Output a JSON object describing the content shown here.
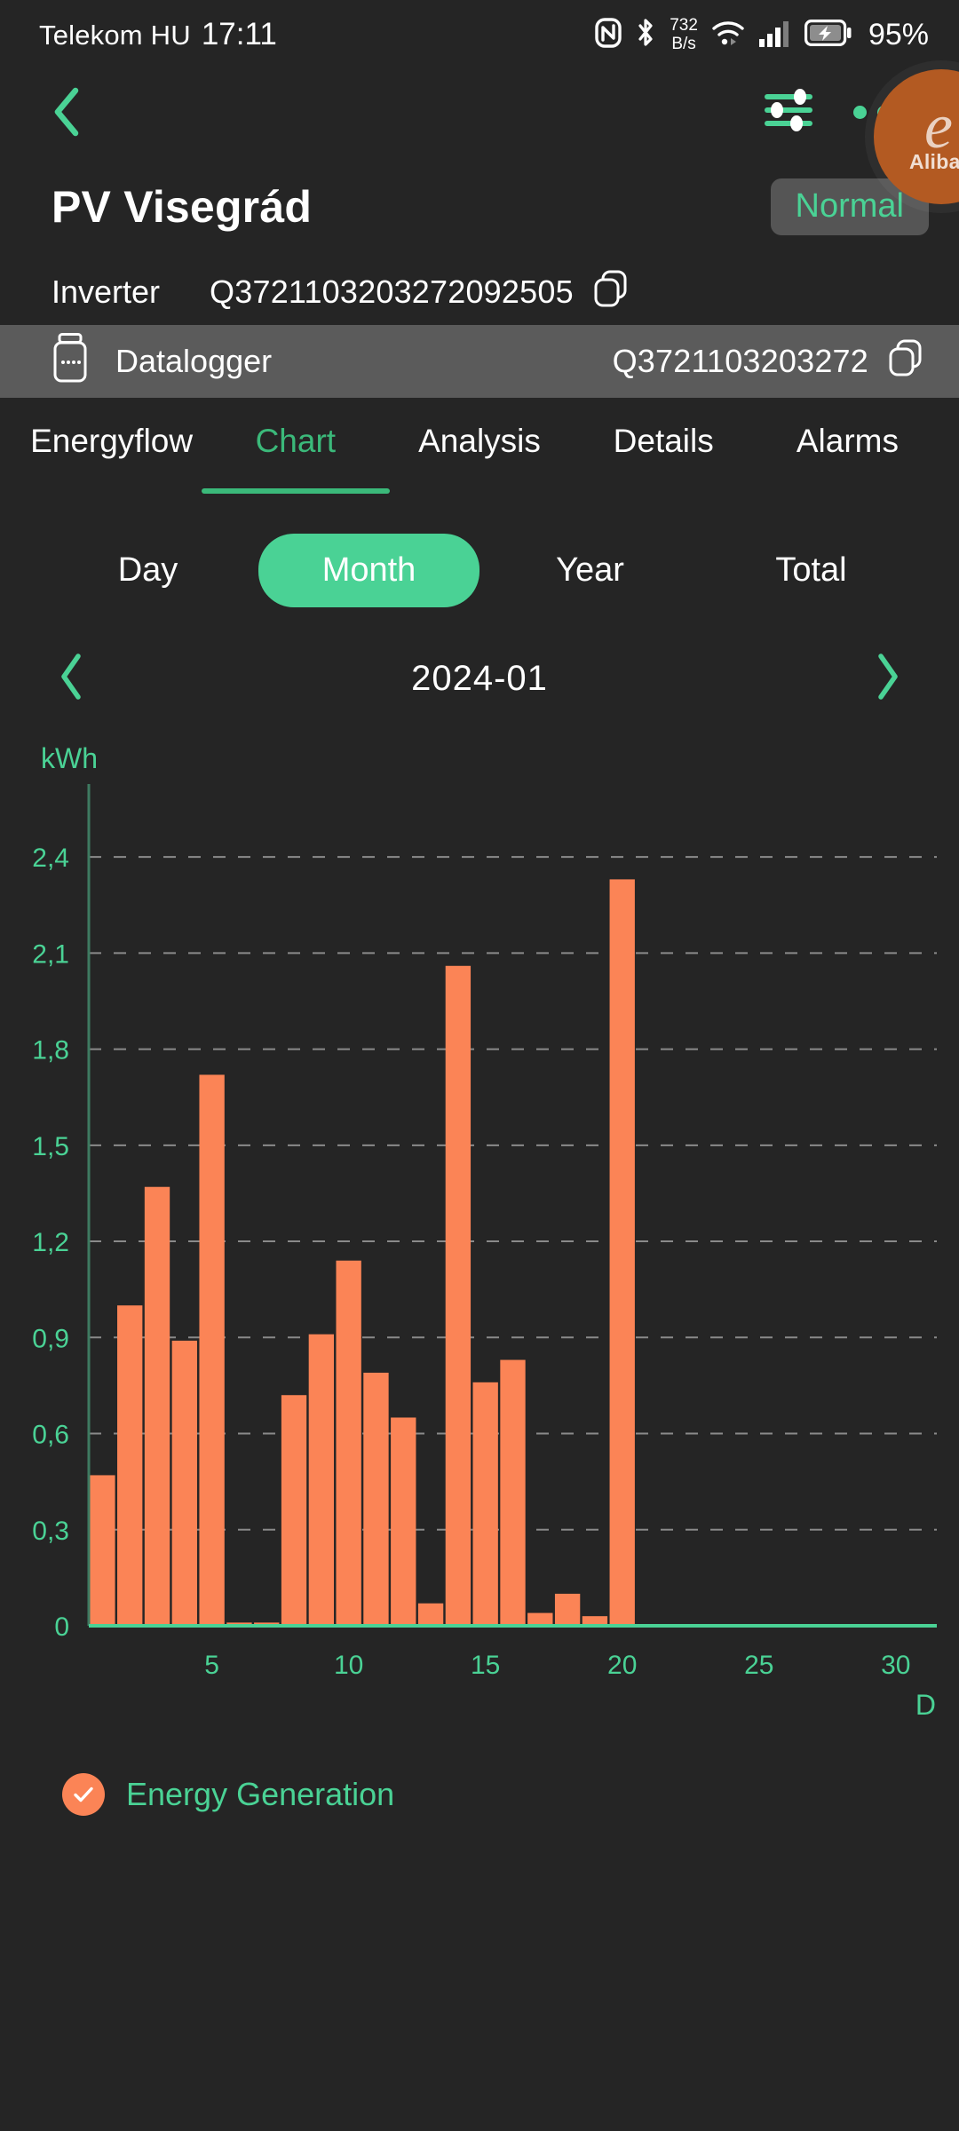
{
  "status_bar": {
    "carrier": "Telekom HU",
    "time": "17:11",
    "network_speed_value": "732",
    "network_speed_unit": "B/s",
    "battery_percent": "95%",
    "icons": [
      "nfc-icon",
      "bluetooth-icon",
      "wifi-icon",
      "cellular-signal-icon",
      "battery-charging-icon"
    ]
  },
  "nav_bar": {
    "back_icon": "chevron-left-icon",
    "settings_icon": "sliders-icon",
    "more_icon": "more-dots-icon",
    "floating_badge": {
      "mark": "e",
      "name": "Alibab"
    }
  },
  "header": {
    "title": "PV Visegrád",
    "status_badge": "Normal"
  },
  "devices": {
    "inverter": {
      "label": "Inverter",
      "value": "Q3721103203272092505",
      "copy_icon": "copy-icon"
    },
    "datalogger": {
      "label": "Datalogger",
      "value": "Q3721103203272",
      "device_icon": "datalogger-icon",
      "copy_icon": "copy-icon"
    }
  },
  "tabs": [
    {
      "label": "Energyflow",
      "active": false
    },
    {
      "label": "Chart",
      "active": true
    },
    {
      "label": "Analysis",
      "active": false
    },
    {
      "label": "Details",
      "active": false
    },
    {
      "label": "Alarms",
      "active": false
    }
  ],
  "periods": [
    {
      "label": "Day",
      "active": false
    },
    {
      "label": "Month",
      "active": true
    },
    {
      "label": "Year",
      "active": false
    },
    {
      "label": "Total",
      "active": false
    }
  ],
  "date_nav": {
    "prev_icon": "chevron-left-icon",
    "next_icon": "chevron-right-icon",
    "current": "2024-01"
  },
  "legend": [
    {
      "label": "Energy Generation",
      "color": "#fb8456",
      "checked": true,
      "check_icon": "check-icon"
    }
  ],
  "colors": {
    "background": "#252525",
    "accent_green": "#4ad295",
    "tab_active_green": "#3bb97a",
    "bar_orange": "#fb8456",
    "badge_grey": "#555555",
    "datalogger_row": "#5b5b5b",
    "grid_dash": "#8a8a8a"
  },
  "chart_data": {
    "type": "bar",
    "title": "",
    "xlabel": "D",
    "ylabel": "kWh",
    "ylim": [
      0,
      2.55
    ],
    "xlim": [
      0.5,
      31.5
    ],
    "grid": true,
    "y_ticks": [
      "0",
      "0,3",
      "0,6",
      "0,9",
      "1,2",
      "1,5",
      "1,8",
      "2,1",
      "2,4"
    ],
    "y_tick_values": [
      0,
      0.3,
      0.6,
      0.9,
      1.2,
      1.5,
      1.8,
      2.1,
      2.4
    ],
    "x_ticks": [
      "5",
      "10",
      "15",
      "20",
      "25",
      "30"
    ],
    "x_tick_values": [
      5,
      10,
      15,
      20,
      25,
      30
    ],
    "decimal_separator": ",",
    "legend_position": "bottom-left",
    "categories": [
      1,
      2,
      3,
      4,
      5,
      6,
      7,
      8,
      9,
      10,
      11,
      12,
      13,
      14,
      15,
      16,
      17,
      18,
      19,
      20,
      21,
      22,
      23,
      24,
      25,
      26,
      27,
      28,
      29,
      30,
      31
    ],
    "series": [
      {
        "name": "Energy Generation",
        "color": "#fb8456",
        "unit": "kWh",
        "values": [
          0.47,
          1.0,
          1.37,
          0.89,
          1.72,
          0.01,
          0.01,
          0.72,
          0.91,
          1.14,
          0.79,
          0.65,
          0.07,
          2.06,
          0.76,
          0.83,
          0.04,
          0.1,
          0.03,
          2.33,
          0,
          0,
          0,
          0,
          0,
          0,
          0,
          0,
          0,
          0,
          0
        ]
      }
    ]
  }
}
